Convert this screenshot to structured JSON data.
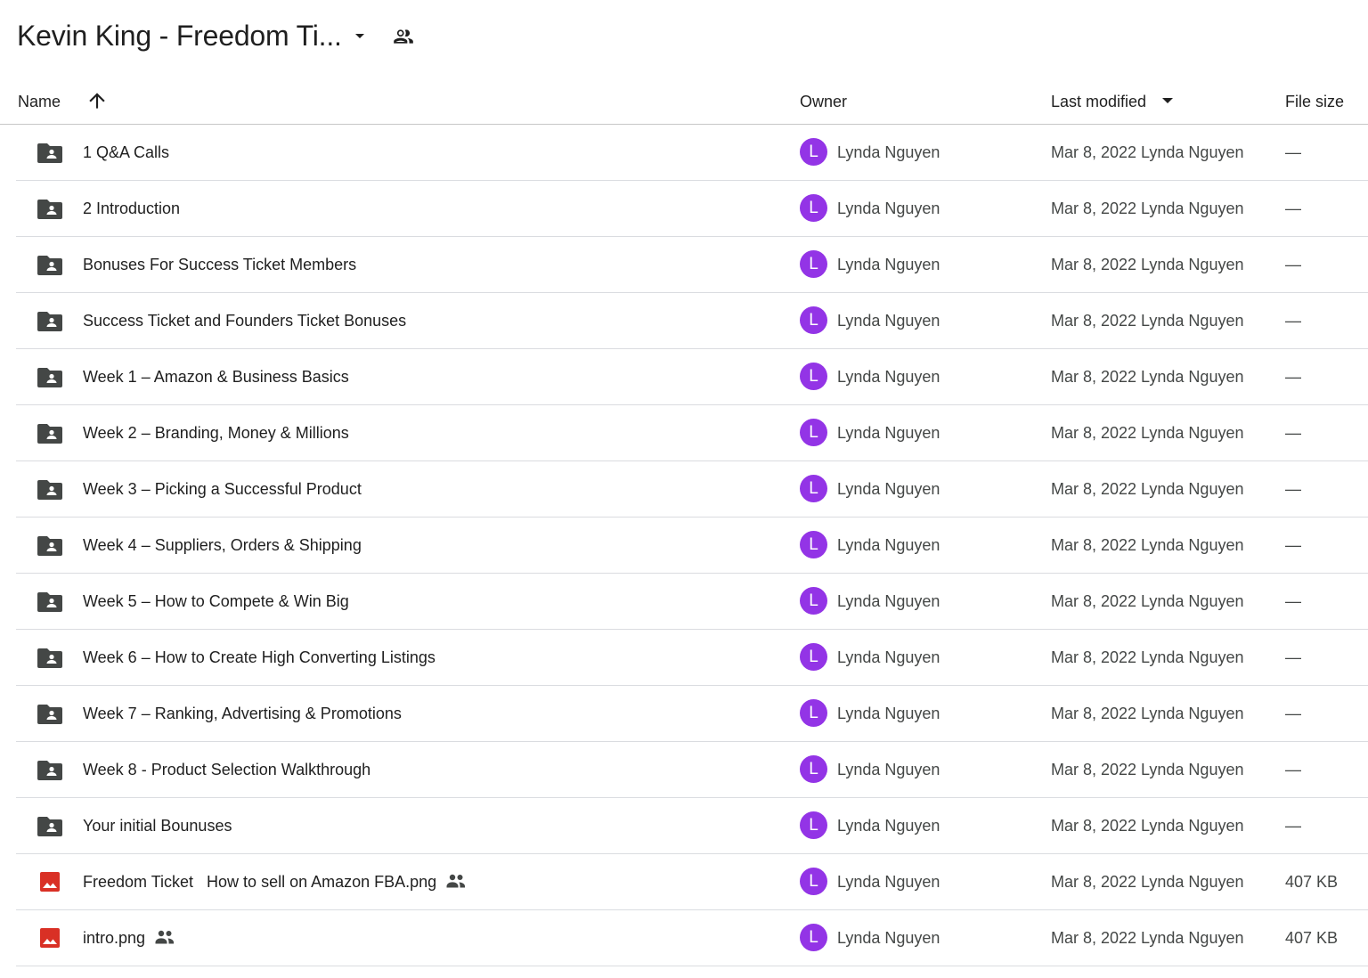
{
  "header": {
    "title": "Kevin King - Freedom Ti..."
  },
  "columns": {
    "name": "Name",
    "owner": "Owner",
    "last_modified": "Last modified",
    "file_size": "File size"
  },
  "colors": {
    "avatar": "#9334e6",
    "folder_icon": "#444746",
    "image_icon": "#d93025"
  },
  "rows": [
    {
      "type": "folder",
      "name": "1 Q&A Calls",
      "shared": false,
      "avatar": "L",
      "owner": "Lynda Nguyen",
      "modified": "Mar 8, 2022 Lynda Nguyen",
      "size": "—"
    },
    {
      "type": "folder",
      "name": "2 Introduction",
      "shared": false,
      "avatar": "L",
      "owner": "Lynda Nguyen",
      "modified": "Mar 8, 2022 Lynda Nguyen",
      "size": "—"
    },
    {
      "type": "folder",
      "name": "Bonuses For Success Ticket Members",
      "shared": false,
      "avatar": "L",
      "owner": "Lynda Nguyen",
      "modified": "Mar 8, 2022 Lynda Nguyen",
      "size": "—"
    },
    {
      "type": "folder",
      "name": "Success Ticket and Founders Ticket Bonuses",
      "shared": false,
      "avatar": "L",
      "owner": "Lynda Nguyen",
      "modified": "Mar 8, 2022 Lynda Nguyen",
      "size": "—"
    },
    {
      "type": "folder",
      "name": "Week 1 – Amazon & Business Basics",
      "shared": false,
      "avatar": "L",
      "owner": "Lynda Nguyen",
      "modified": "Mar 8, 2022 Lynda Nguyen",
      "size": "—"
    },
    {
      "type": "folder",
      "name": "Week 2 – Branding, Money & Millions",
      "shared": false,
      "avatar": "L",
      "owner": "Lynda Nguyen",
      "modified": "Mar 8, 2022 Lynda Nguyen",
      "size": "—"
    },
    {
      "type": "folder",
      "name": "Week 3 – Picking a Successful Product",
      "shared": false,
      "avatar": "L",
      "owner": "Lynda Nguyen",
      "modified": "Mar 8, 2022 Lynda Nguyen",
      "size": "—"
    },
    {
      "type": "folder",
      "name": "Week 4 – Suppliers, Orders & Shipping",
      "shared": false,
      "avatar": "L",
      "owner": "Lynda Nguyen",
      "modified": "Mar 8, 2022 Lynda Nguyen",
      "size": "—"
    },
    {
      "type": "folder",
      "name": "Week 5 – How to Compete & Win Big",
      "shared": false,
      "avatar": "L",
      "owner": "Lynda Nguyen",
      "modified": "Mar 8, 2022 Lynda Nguyen",
      "size": "—"
    },
    {
      "type": "folder",
      "name": "Week 6 – How to Create High Converting Listings",
      "shared": false,
      "avatar": "L",
      "owner": "Lynda Nguyen",
      "modified": "Mar 8, 2022 Lynda Nguyen",
      "size": "—"
    },
    {
      "type": "folder",
      "name": "Week 7 – Ranking, Advertising & Promotions",
      "shared": false,
      "avatar": "L",
      "owner": "Lynda Nguyen",
      "modified": "Mar 8, 2022 Lynda Nguyen",
      "size": "—"
    },
    {
      "type": "folder",
      "name": "Week 8 - Product Selection Walkthrough",
      "shared": false,
      "avatar": "L",
      "owner": "Lynda Nguyen",
      "modified": "Mar 8, 2022 Lynda Nguyen",
      "size": "—"
    },
    {
      "type": "folder",
      "name": "Your initial Bounuses",
      "shared": false,
      "avatar": "L",
      "owner": "Lynda Nguyen",
      "modified": "Mar 8, 2022 Lynda Nguyen",
      "size": "—"
    },
    {
      "type": "image",
      "name": "Freedom Ticket   How to sell on Amazon FBA.png",
      "shared": true,
      "avatar": "L",
      "owner": "Lynda Nguyen",
      "modified": "Mar 8, 2022 Lynda Nguyen",
      "size": "407 KB"
    },
    {
      "type": "image",
      "name": "intro.png",
      "shared": true,
      "avatar": "L",
      "owner": "Lynda Nguyen",
      "modified": "Mar 8, 2022 Lynda Nguyen",
      "size": "407 KB"
    }
  ]
}
